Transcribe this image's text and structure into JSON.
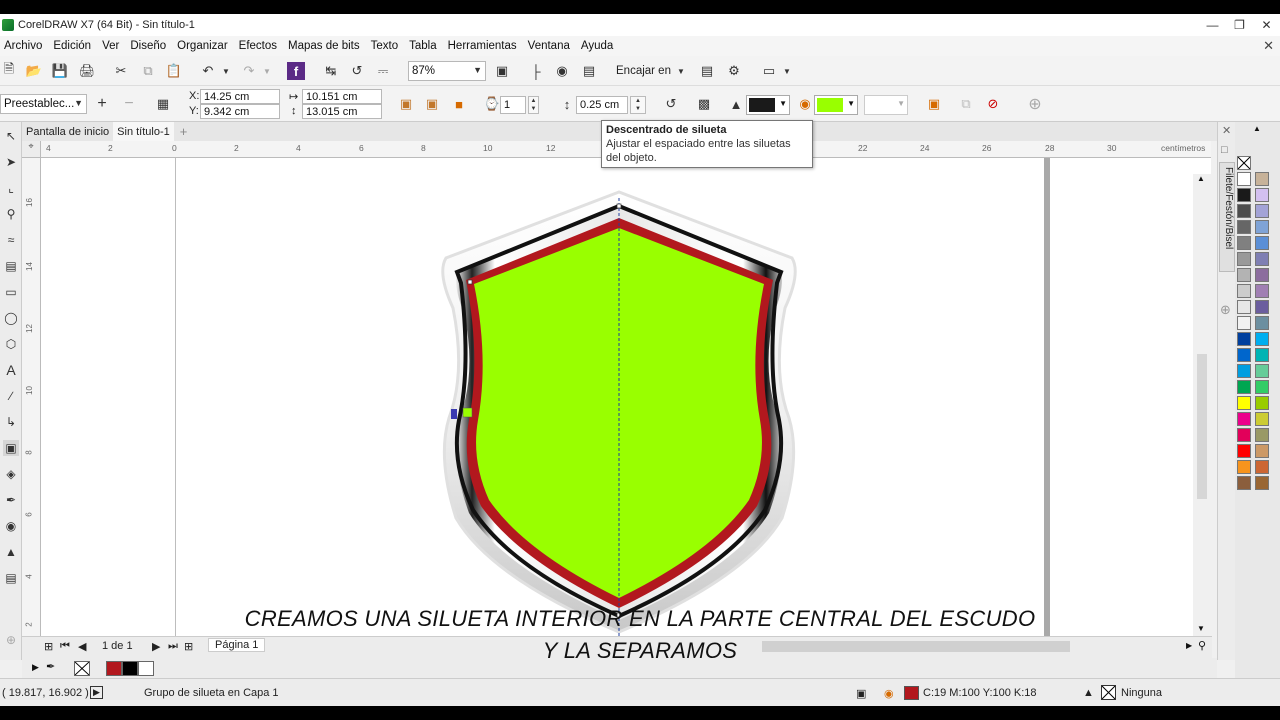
{
  "window": {
    "title": "CorelDRAW X7 (64 Bit) - Sin título-1"
  },
  "menu": [
    "Archivo",
    "Edición",
    "Ver",
    "Diseño",
    "Organizar",
    "Efectos",
    "Mapas de bits",
    "Texto",
    "Tabla",
    "Herramientas",
    "Ventana",
    "Ayuda"
  ],
  "toolbar": {
    "zoom": "87%",
    "snap_label": "Encajar en"
  },
  "property_bar": {
    "preset": "Preestablec...",
    "x_label": "X:",
    "x_value": "14.25 cm",
    "y_label": "Y:",
    "y_value": "9.342 cm",
    "width_value": "10.151 cm",
    "height_value": "13.015 cm",
    "steps": "1",
    "offset": "0.25 cm",
    "outline_color": "#1a1a1a",
    "fill_color": "#99ff00"
  },
  "tooltip": {
    "title": "Descentrado de silueta",
    "body": "Ajustar el espaciado entre las siluetas del objeto."
  },
  "tabs": [
    "Pantalla de inicio",
    "Sin título-1"
  ],
  "ruler": {
    "units": "centímetros",
    "h_ticks": [
      "4",
      "2",
      "0",
      "2",
      "4",
      "6",
      "8",
      "10",
      "12",
      "22",
      "24",
      "26",
      "28",
      "30"
    ],
    "v_ticks": [
      "16",
      "14",
      "12",
      "10",
      "8",
      "6",
      "4",
      "2"
    ]
  },
  "caption": {
    "line1": "CREAMOS UNA SILUETA INTERIOR EN LA PARTE CENTRAL DEL ESCUDO",
    "line2": "Y LA SEPARAMOS"
  },
  "page_nav": {
    "page_count": "1 de 1",
    "page_tab": "Página 1"
  },
  "doc_colors": [
    "#b2181e",
    "#000000",
    "#ffffff"
  ],
  "status": {
    "coords": "( 19.817, 16.902 )",
    "object_info": "Grupo de silueta en Capa 1",
    "fill_info": "C:19 M:100 Y:100 K:18",
    "fill_swatch": "#b2181e",
    "outline_info": "Ninguna"
  },
  "docker": {
    "label": "Filete/Festón/Bisel"
  },
  "palette": [
    "#ffffff",
    "#1a1a1a",
    "#4d4d4d",
    "#666666",
    "#808080",
    "#999999",
    "#b3b3b3",
    "#cccccc",
    "#e6e6e6",
    "#f2f2f2",
    "#003f9e",
    "#0066cc",
    "#009ee0",
    "#00a651",
    "#ffff00",
    "#ec008c",
    "#e2005a",
    "#ff0000",
    "#f7941d",
    "#8b5e3c",
    "#c7b299",
    "#d3c0f0",
    "#a3a3d6",
    "#7fa3d6",
    "#5b8fd6",
    "#7f7fb3",
    "#8c6d9e",
    "#a07fb3",
    "#6b5e9e",
    "#6c8fa0",
    "#00aeef",
    "#00b4b4",
    "#66cc99",
    "#33cc66",
    "#99cc00",
    "#cccc33",
    "#999966",
    "#cc9966",
    "#cc6633",
    "#996633"
  ],
  "icons": [
    "new-icon",
    "open-icon",
    "save-icon",
    "print-icon",
    "cut-icon",
    "copy-icon",
    "paste-icon",
    "undo-icon",
    "redo-icon",
    "search-icon",
    "import-icon",
    "export-icon",
    "publish-icon",
    "fullscreen-icon",
    "ruler-icon",
    "grid-icon",
    "guides-icon",
    "options-icon",
    "launch-icon"
  ]
}
